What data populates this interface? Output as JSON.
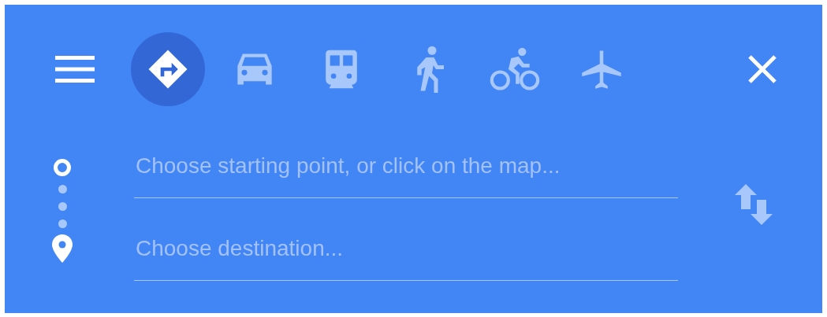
{
  "travel_modes": [
    {
      "kind": "best",
      "selected": true
    },
    {
      "kind": "car",
      "selected": false
    },
    {
      "kind": "transit",
      "selected": false
    },
    {
      "kind": "walk",
      "selected": false
    },
    {
      "kind": "bike",
      "selected": false
    },
    {
      "kind": "flight",
      "selected": false
    }
  ],
  "fields": [
    {
      "kind": "start",
      "placeholder": "Choose starting point, or click on the map..."
    },
    {
      "kind": "destination",
      "placeholder": "Choose destination..."
    }
  ]
}
